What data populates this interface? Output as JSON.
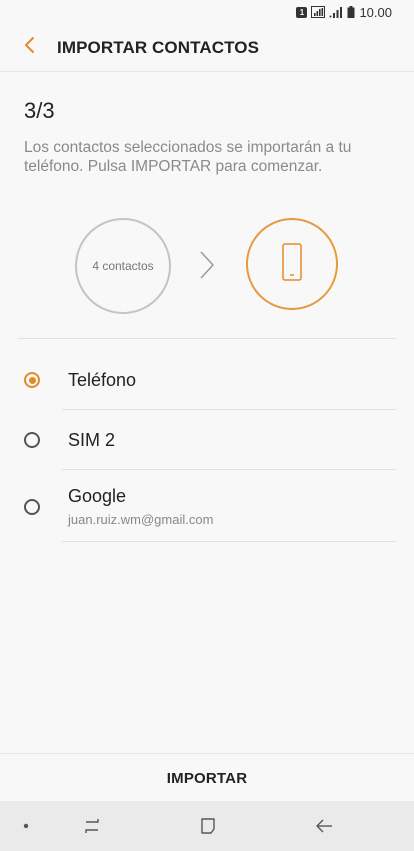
{
  "status_bar": {
    "sim_label": "1",
    "time": "10.00",
    "icons": [
      "sim-icon",
      "signal-wifi-icon",
      "signal-bars-icon",
      "battery-icon"
    ]
  },
  "header": {
    "title": "IMPORTAR CONTACTOS",
    "back_icon": "chevron-left-icon"
  },
  "step": {
    "counter": "3/3",
    "description": "Los contactos seleccionados se importarán a tu teléfono. Pulsa IMPORTAR para comenzar."
  },
  "transfer": {
    "source_label": "4 contactos",
    "arrow_icon": "chevron-right-icon",
    "destination_icon": "phone-icon"
  },
  "options": [
    {
      "label": "Teléfono",
      "sublabel": "",
      "selected": true
    },
    {
      "label": "SIM 2",
      "sublabel": "",
      "selected": false
    },
    {
      "label": "Google",
      "sublabel": "juan.ruiz.wm@gmail.com",
      "selected": false
    }
  ],
  "action": {
    "label": "IMPORTAR"
  },
  "nav_bar": {
    "items": [
      "dot-icon",
      "recents-icon",
      "home-icon",
      "back-arrow-icon"
    ]
  },
  "colors": {
    "accent": "#e58a2b",
    "background": "#f8f8f8",
    "nav_background": "#eaeaea",
    "secondary_text": "#8a8a8a"
  }
}
